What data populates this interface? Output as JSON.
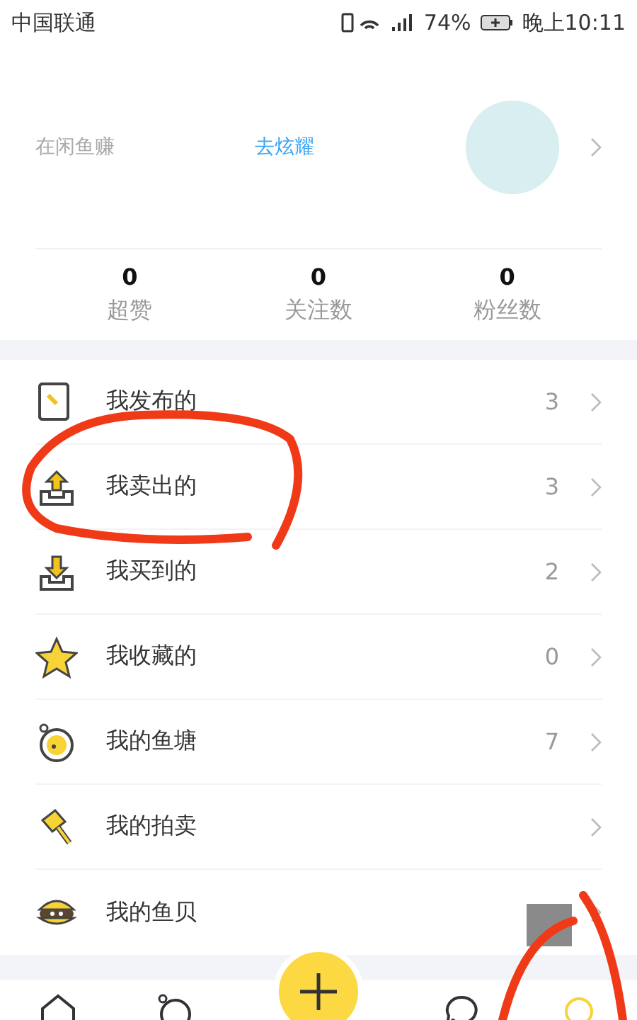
{
  "status_bar": {
    "carrier": "中国联通",
    "battery": "74%",
    "time": "晚上10:11"
  },
  "profile": {
    "note": "在闲鱼赚",
    "link": "去炫耀"
  },
  "stats": [
    {
      "value": "0",
      "label": "超赞"
    },
    {
      "value": "0",
      "label": "关注数"
    },
    {
      "value": "0",
      "label": "粉丝数"
    }
  ],
  "menu": [
    {
      "kind": "published",
      "label": "我发布的",
      "count": "3"
    },
    {
      "kind": "sold",
      "label": "我卖出的",
      "count": "3"
    },
    {
      "kind": "bought",
      "label": "我买到的",
      "count": "2"
    },
    {
      "kind": "favorites",
      "label": "我收藏的",
      "count": "0"
    },
    {
      "kind": "pond",
      "label": "我的鱼塘",
      "count": "7"
    },
    {
      "kind": "auction",
      "label": "我的拍卖"
    },
    {
      "kind": "shells",
      "label": "我的鱼贝"
    }
  ],
  "tab_bar": [
    {
      "kind": "home",
      "selected": false
    },
    {
      "kind": "pond",
      "selected": false
    },
    {
      "kind": "publish",
      "selected": false
    },
    {
      "kind": "messages",
      "selected": false
    },
    {
      "kind": "me",
      "selected": true
    }
  ]
}
